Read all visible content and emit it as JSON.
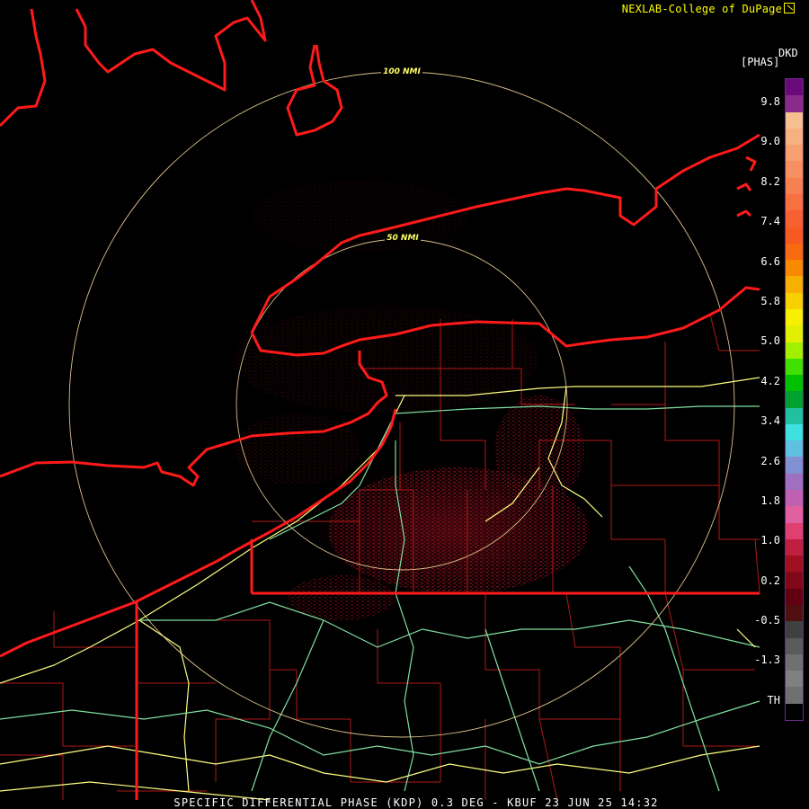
{
  "credit": "NEXLAB-College of DuPage",
  "credit_icon": "cursor-arrow-icon",
  "product_code": "DKD",
  "units": "[PHAS]",
  "range_rings": [
    {
      "label": "50 NMI"
    },
    {
      "label": "100 NMI"
    }
  ],
  "legend": {
    "labels": [
      "9.8",
      "9.0",
      "8.2",
      "7.4",
      "6.6",
      "5.8",
      "5.0",
      "4.2",
      "3.4",
      "2.6",
      "1.8",
      "1.0",
      "0.2",
      "-0.5",
      "-1.3",
      "TH"
    ]
  },
  "footer": "SPECIFIC DIFFERENTIAL PHASE (KDP) 0.3 DEG - KBUF 23 JUN 25 14:32",
  "colors": {
    "state_border": "#ff1a1a",
    "county_border": "#b01818",
    "highway": "#ffff80",
    "highway_secondary": "#80e0a0",
    "range_ring": "#ffe0a0",
    "echo": "#7a0c18"
  }
}
